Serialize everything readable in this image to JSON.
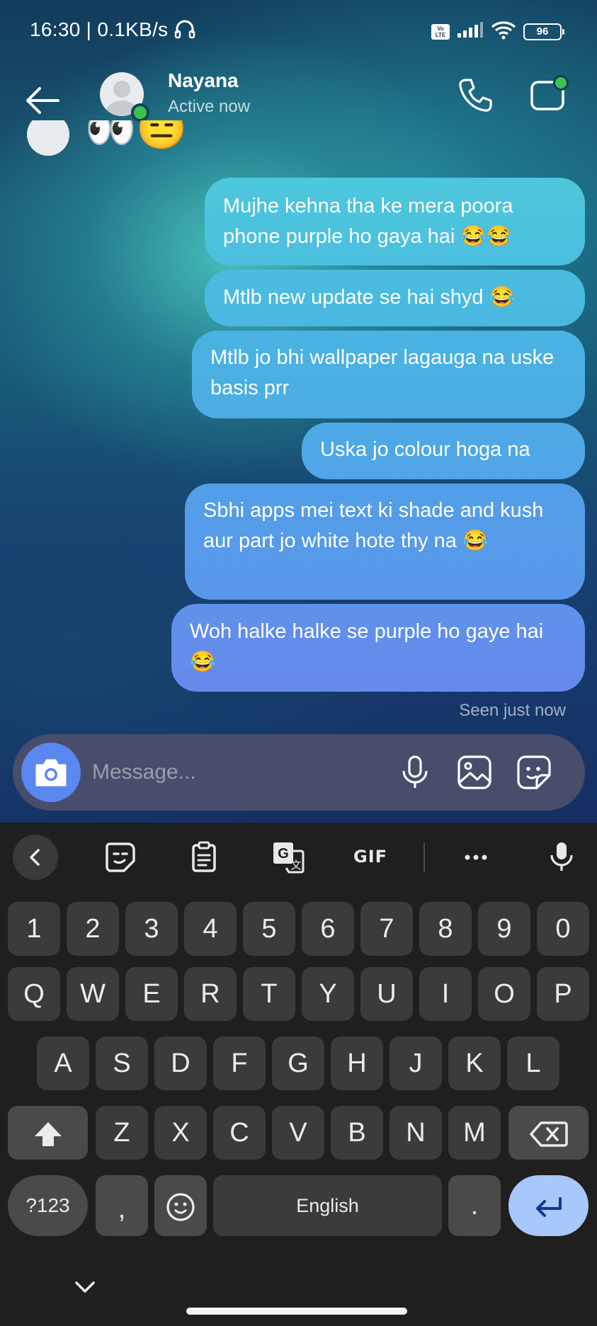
{
  "status_bar": {
    "time": "16:30",
    "network_speed": "| 0.1KB/s",
    "volte": "Vo LTE",
    "battery": "96"
  },
  "header": {
    "contact_name": "Nayana",
    "contact_status": "Active now"
  },
  "previous_message": {
    "emoji": "👀😑"
  },
  "messages": [
    {
      "text": "Mujhe kehna tha ke mera poora phone purple ho gaya hai 😂😂"
    },
    {
      "text": "Mtlb new update se hai shyd 😂"
    },
    {
      "text": "Mtlb jo bhi wallpaper lagauga na uske basis prr"
    },
    {
      "text": "Uska jo colour hoga na"
    },
    {
      "text": "Sbhi apps mei text ki shade and kush aur part jo white hote thy na 😂"
    },
    {
      "text": "Woh halke halke se purple ho gaye hai 😂"
    }
  ],
  "seen_status": "Seen just now",
  "composer": {
    "placeholder": "Message..."
  },
  "keyboard": {
    "toolbar": {
      "gif": "GIF"
    },
    "row_numbers": [
      "1",
      "2",
      "3",
      "4",
      "5",
      "6",
      "7",
      "8",
      "9",
      "0"
    ],
    "row_qwerty": [
      "Q",
      "W",
      "E",
      "R",
      "T",
      "Y",
      "U",
      "I",
      "O",
      "P"
    ],
    "row_asdf": [
      "A",
      "S",
      "D",
      "F",
      "G",
      "H",
      "J",
      "K",
      "L"
    ],
    "row_zxcv": [
      "Z",
      "X",
      "C",
      "V",
      "B",
      "N",
      "M"
    ],
    "symbols_key": "?123",
    "comma_key": ",",
    "space_key": "English",
    "period_key": "."
  },
  "colors": {
    "bubble_top": "#4ec7dc",
    "bubble_bottom": "#6689ec",
    "online": "#3ac34f",
    "enter_key": "#a8c7fa",
    "camera_button": "#5b87f0"
  }
}
